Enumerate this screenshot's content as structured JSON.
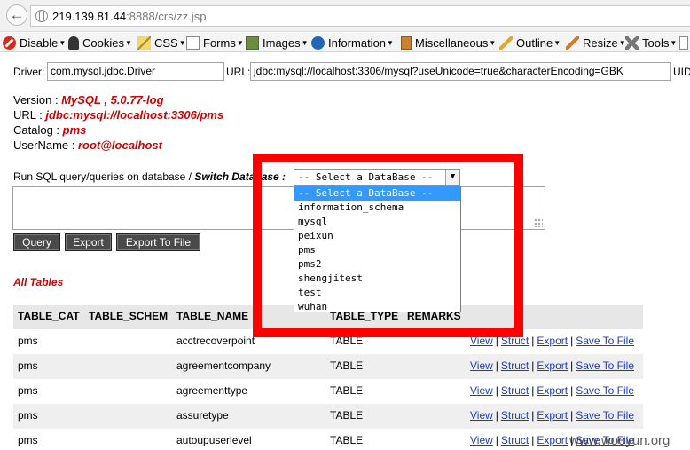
{
  "browser": {
    "url_host": "219.139.81.44",
    "url_rest": ":8888/crs/zz.jsp"
  },
  "toolbar": {
    "items": [
      {
        "label": "Disable",
        "icon": "disable-icon"
      },
      {
        "label": "Cookies",
        "icon": "cookies-icon"
      },
      {
        "label": "CSS",
        "icon": "css-icon"
      },
      {
        "label": "Forms",
        "icon": "forms-icon"
      },
      {
        "label": "Images",
        "icon": "images-icon"
      },
      {
        "label": "Information",
        "icon": "information-icon"
      },
      {
        "label": "Miscellaneous",
        "icon": "miscellaneous-icon"
      },
      {
        "label": "Outline",
        "icon": "outline-icon"
      },
      {
        "label": "Resize",
        "icon": "resize-icon"
      },
      {
        "label": "Tools",
        "icon": "tools-icon"
      }
    ]
  },
  "connection": {
    "driver_label": "Driver:",
    "driver_value": "com.mysql.jdbc.Driver",
    "url_label": "URL:",
    "url_value": "jdbc:mysql://localhost:3306/mysql?useUnicode=true&characterEncoding=GBK",
    "uid_label": "UID"
  },
  "info": {
    "version_label": "Version : ",
    "version_value": "MySQL , 5.0.77-log",
    "url_label": "URL : ",
    "url_value": "jdbc:mysql://localhost:3306/pms",
    "catalog_label": "Catalog : ",
    "catalog_value": "pms",
    "username_label": "UserName : ",
    "username_value": "root@localhost"
  },
  "query": {
    "run_text": "Run SQL query/queries on database / ",
    "switch_label": "Switch Database :",
    "select_value": "-- Select a DataBase --",
    "options": [
      "-- Select a DataBase --",
      "information_schema",
      "mysql",
      "peixun",
      "pms",
      "pms2",
      "shengjitest",
      "test",
      "wuhan"
    ],
    "buttons": {
      "query": "Query",
      "export": "Export",
      "export_to_file": "Export To File"
    }
  },
  "tables": {
    "title": "All Tables",
    "headers": [
      "TABLE_CAT",
      "TABLE_SCHEM",
      "TABLE_NAME",
      "TABLE_TYPE",
      "REMARKS"
    ],
    "actions": [
      "View",
      "Struct",
      "Export",
      "Save To File"
    ],
    "rows": [
      {
        "cat": "pms",
        "name": "acctrecoverpoint",
        "type": "TABLE"
      },
      {
        "cat": "pms",
        "name": "agreementcompany",
        "type": "TABLE"
      },
      {
        "cat": "pms",
        "name": "agreementtype",
        "type": "TABLE"
      },
      {
        "cat": "pms",
        "name": "assuretype",
        "type": "TABLE"
      },
      {
        "cat": "pms",
        "name": "autoupuserlevel",
        "type": "TABLE"
      }
    ]
  },
  "watermark": "www.wooyun.org"
}
